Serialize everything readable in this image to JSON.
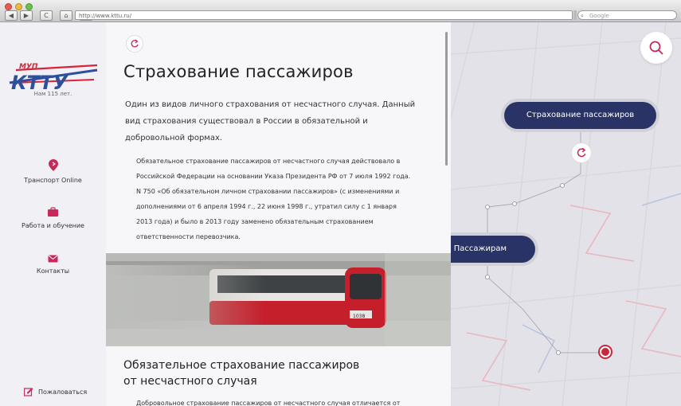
{
  "browser": {
    "url": "http://www.kttu.ru/",
    "search_placeholder": "Google",
    "nav_back": "◀",
    "nav_forward": "▶",
    "nav_reload": "C",
    "nav_home": "⌂",
    "nav_add": "+"
  },
  "sidebar": {
    "logo_top": "МУП",
    "logo_main": "КТТУ",
    "years": "Нам 115 лет.",
    "items": [
      {
        "label": "Транспорт Online",
        "icon": "pin-icon"
      },
      {
        "label": "Работа и обучение",
        "icon": "briefcase-icon"
      },
      {
        "label": "Контакты",
        "icon": "envelope-icon"
      }
    ],
    "complain": "Пожаловаться"
  },
  "article": {
    "title": "Страхование пассажиров",
    "lead": "Один из видов личного страхования от несчастного случая. Данный вид страхования существовал в России в обязательной и добровольной формах.",
    "body1": "Обязательное страхование пассажиров от несчастного случая действовало в Российской Федерации на основании Указа Президента РФ от 7 июля 1992 года. N 750 «Об обязательном личном страховании пассажиров» (с изменениями и дополнениями от 6 апреля 1994 г., 22 июня 1998 г., утратил силу с 1 января 2013 года) и было в 2013 году заменено обязательным страхованием ответственности перевозчика.",
    "tram_number": "1038",
    "subtitle_line1": "Обязательное страхование пассажиров",
    "subtitle_line2": "от несчастного случая",
    "body2": "Добровольное страхование пассажиров от несчастного случая отличается от"
  },
  "map": {
    "node_current": "Страхование пассажиров",
    "node_parent": "Пассажирам"
  },
  "colors": {
    "accent": "#c8285a",
    "navy": "#2a3366",
    "logo_red": "#d5253a",
    "logo_blue": "#2d4f9e"
  }
}
